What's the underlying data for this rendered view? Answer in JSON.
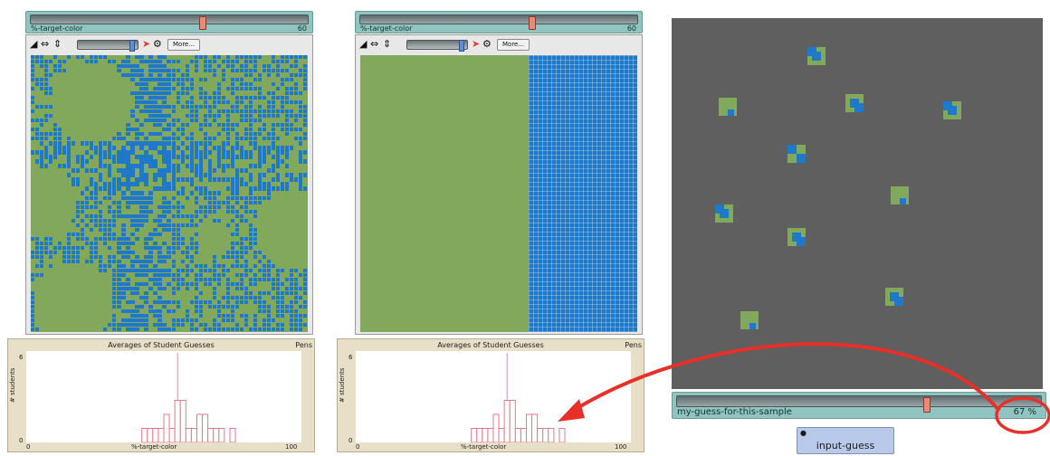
{
  "panels": [
    {
      "slider": {
        "label": "%-target-color",
        "value": "60",
        "level": 0.6
      },
      "toolbar": {
        "more_label": "More..."
      },
      "plot": {
        "title": "Averages of Student Guesses",
        "pens": "Pens",
        "ylabel": "# students",
        "xlabel": "%-target-color",
        "y_tick_top": "6",
        "y_tick_bottom": "0",
        "x_tick_min": "0",
        "x_tick_max": "100"
      }
    },
    {
      "slider": {
        "label": "%-target-color",
        "value": "60",
        "level": 0.6
      },
      "toolbar": {
        "more_label": "More..."
      },
      "plot": {
        "title": "Averages of Student Guesses",
        "pens": "Pens",
        "ylabel": "# students",
        "xlabel": "%-target-color",
        "y_tick_top": "6",
        "y_tick_bottom": "0",
        "x_tick_min": "0",
        "x_tick_max": "100"
      }
    }
  ],
  "histogram": {
    "x_range": [
      0,
      100
    ],
    "y_range": [
      0,
      6
    ],
    "marker_x": 55,
    "bins": [
      [
        42,
        1
      ],
      [
        44,
        1
      ],
      [
        46,
        1
      ],
      [
        48,
        1
      ],
      [
        50,
        2
      ],
      [
        52,
        1
      ],
      [
        54,
        3
      ],
      [
        56,
        3
      ],
      [
        58,
        1
      ],
      [
        60,
        1
      ],
      [
        62,
        2
      ],
      [
        64,
        2
      ],
      [
        66,
        1
      ],
      [
        68,
        1
      ],
      [
        70,
        1
      ],
      [
        74,
        1
      ]
    ]
  },
  "guess_slider": {
    "label": "my-guess-for-this-sample",
    "value": "67 %",
    "level": 0.67
  },
  "input_button": {
    "label": "input-guess"
  },
  "colors": {
    "target": "#1f78c8",
    "background": "#82a95b",
    "dark_world": "#5f5f5f",
    "annotation": "#e8302a"
  }
}
